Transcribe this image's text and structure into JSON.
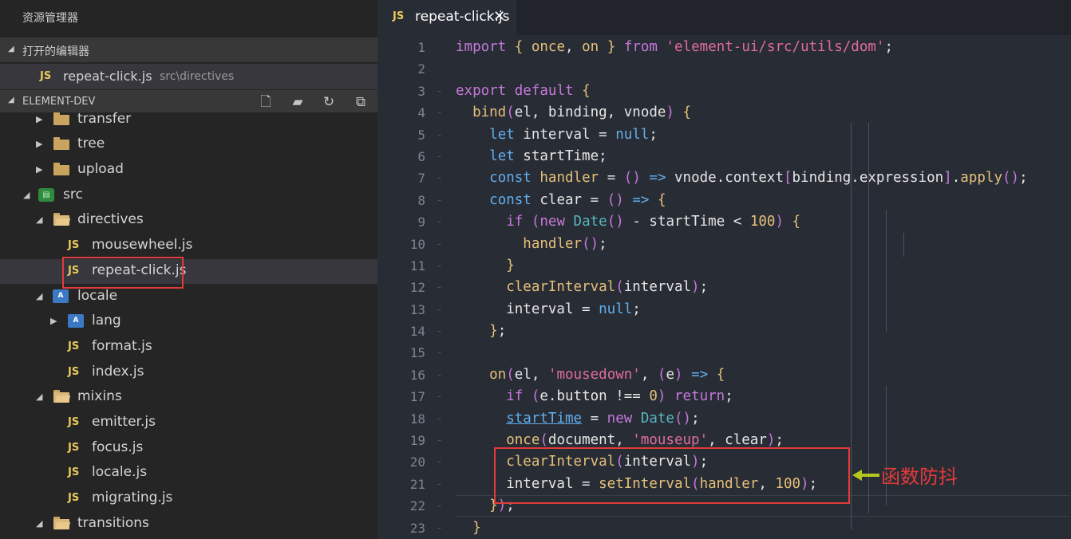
{
  "sidebar": {
    "title": "资源管理器",
    "open_editors_label": "打开的编辑器",
    "open_file": {
      "icon": "JS",
      "name": "repeat-click.js",
      "path": "src\\directives"
    },
    "project_label": "ELEMENT-DEV",
    "toolbar": [
      "new-file-icon",
      "new-folder-icon",
      "refresh-icon",
      "collapse-all-icon"
    ],
    "tree": [
      {
        "label": "transfer",
        "type": "folder",
        "expanded": false
      },
      {
        "label": "tree",
        "type": "folder",
        "expanded": false
      },
      {
        "label": "upload",
        "type": "folder",
        "expanded": false
      },
      {
        "label": "src",
        "type": "src",
        "expanded": true
      },
      {
        "label": "directives",
        "type": "folder",
        "expanded": true
      },
      {
        "label": "mousewheel.js",
        "type": "js"
      },
      {
        "label": "repeat-click.js",
        "type": "js",
        "selected": true
      },
      {
        "label": "locale",
        "type": "locale",
        "expanded": true
      },
      {
        "label": "lang",
        "type": "locale",
        "expanded": false
      },
      {
        "label": "format.js",
        "type": "js"
      },
      {
        "label": "index.js",
        "type": "js"
      },
      {
        "label": "mixins",
        "type": "folder",
        "expanded": true
      },
      {
        "label": "emitter.js",
        "type": "js"
      },
      {
        "label": "focus.js",
        "type": "js"
      },
      {
        "label": "locale.js",
        "type": "js"
      },
      {
        "label": "migrating.js",
        "type": "js"
      },
      {
        "label": "transitions",
        "type": "folder",
        "expanded": true
      }
    ]
  },
  "editor": {
    "tab": {
      "icon": "JS",
      "name": "repeat-click.js",
      "close": "✕"
    },
    "line_numbers": [
      "1",
      "2",
      "3",
      "4",
      "5",
      "6",
      "7",
      "8",
      "9",
      "10",
      "11",
      "12",
      "13",
      "14",
      "15",
      "16",
      "17",
      "18",
      "19",
      "20",
      "21",
      "22",
      "23"
    ],
    "lines": [
      "import { once, on } from 'element-ui/src/utils/dom';",
      "",
      "export default {",
      "  bind(el, binding, vnode) {",
      "    let interval = null;",
      "    let startTime;",
      "    const handler = () => vnode.context[binding.expression].apply();",
      "    const clear = () => {",
      "      if (new Date() - startTime < 100) {",
      "        handler();",
      "      }",
      "      clearInterval(interval);",
      "      interval = null;",
      "    };",
      "",
      "    on(el, 'mousedown', (e) => {",
      "      if (e.button !== 0) return;",
      "      startTime = new Date();",
      "      once(document, 'mouseup', clear);",
      "      clearInterval(interval);",
      "      interval = setInterval(handler, 100);",
      "    });",
      "  }"
    ]
  },
  "annotation": {
    "text": "函数防抖",
    "color": "#e33a3a"
  },
  "colors": {
    "js_icon": "#e8c95a",
    "keyword": "#c678dd",
    "function": "#61afef",
    "string": "#e06c9f",
    "number": "#e5c07b"
  }
}
